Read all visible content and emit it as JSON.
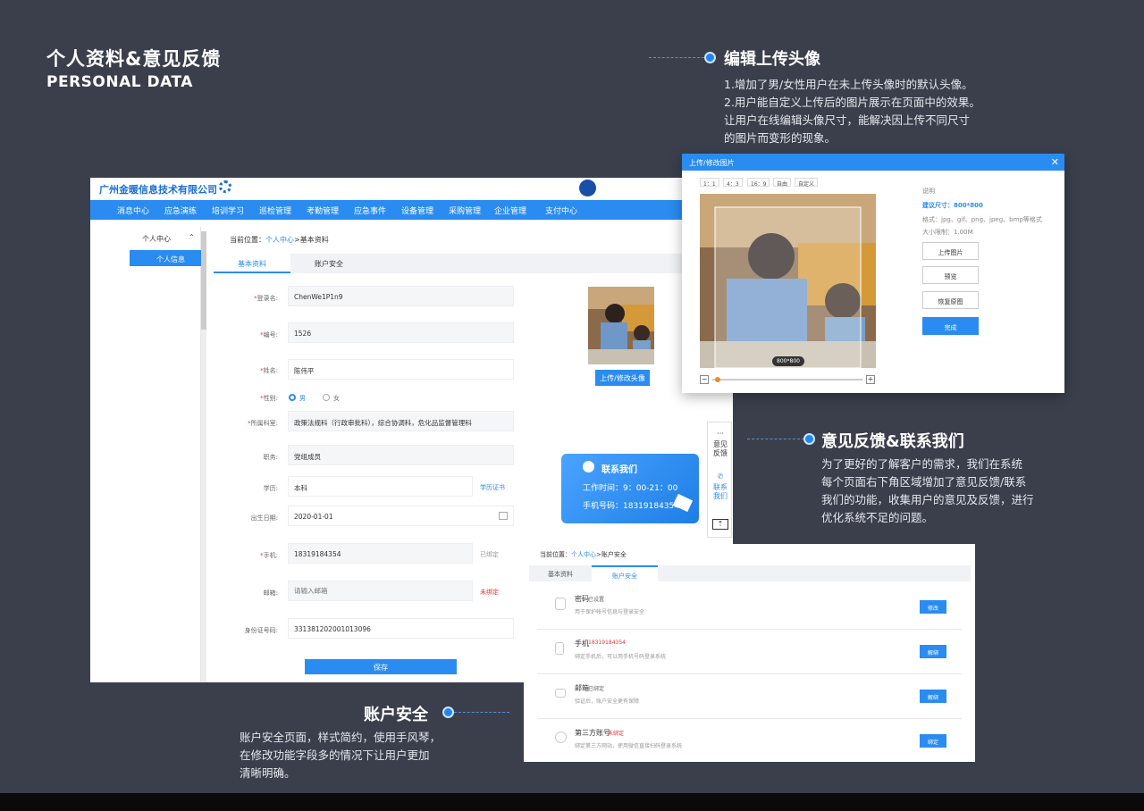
{
  "header": {
    "title": "个人资料&意见反馈",
    "subtitle": "PERSONAL DATA"
  },
  "sections": {
    "avatar": {
      "title": "编辑上传头像",
      "lines": [
        "1.增加了男/女性用户在未上传头像时的默认头像。",
        "2.用户能自定义上传后的图片展示在页面中的效果。",
        "让用户在线编辑头像尺寸，能解决因上传不同尺寸",
        "的图片而变形的现象。"
      ]
    },
    "feedback": {
      "title": "意见反馈&联系我们",
      "lines": [
        "为了更好的了解客户的需求，我们在系统",
        "每个页面右下角区域增加了意见反馈/联系",
        "我们的功能，收集用户的意见及反馈，进行",
        "优化系统不足的问题。"
      ]
    },
    "security": {
      "title": "账户安全",
      "lines": [
        "账户安全页面，样式简约，使用手风琴，",
        "在修改功能字段多的情况下让用户更加",
        "清晰明确。"
      ]
    }
  },
  "main": {
    "company": "广州金暖信息技术有限公司",
    "nav": [
      "消息中心",
      "应急演练",
      "培训学习",
      "巡检管理",
      "考勤管理",
      "应急事件",
      "设备管理",
      "采购管理",
      "企业管理",
      "支付中心"
    ],
    "sidebar": {
      "group": "个人中心",
      "active": "个人信息"
    },
    "breadcrumb": {
      "prefix": "当前位置：",
      "link": "个人中心",
      "current": ">基本资料"
    },
    "tabs": [
      "基本资料",
      "账户安全"
    ],
    "form": {
      "login_label": "登录名:",
      "login_value": "ChenWe1P1n9",
      "id_label": "编号:",
      "id_value": "1526",
      "name_label": "姓名:",
      "name_value": "陈伟平",
      "gender_label": "性别:",
      "gender_male": "男",
      "gender_female": "女",
      "dept_label": "所属科室:",
      "dept_value": "政策法规科（行政审批科），综合协调科，危化品监督管理科",
      "job_label": "职务:",
      "job_value": "党组成员",
      "edu_label": "学历:",
      "edu_value": "本科",
      "edu_link": "学历证书",
      "birth_label": "出生日期:",
      "birth_value": "2020-01-01",
      "phone_label": "手机:",
      "phone_value": "18319184354",
      "phone_status": "已绑定",
      "email_label": "邮箱:",
      "email_placeholder": "请输入邮箱",
      "email_status": "未绑定",
      "idcard_label": "身份证号码:",
      "idcard_value": "331381202001013096",
      "save": "保存"
    },
    "avatar_button": "上传/修改头像"
  },
  "contact": {
    "title": "联系我们",
    "hours": "工作时间：9：00-21：00",
    "phone": "手机号码：18319184354"
  },
  "float_bar": {
    "feedback": "意见反馈",
    "contact": "联系我们"
  },
  "dialog": {
    "title": "上传/修改图片",
    "ratios": [
      "1：1",
      "4：3",
      "16：9",
      "自由",
      "自定义"
    ],
    "size_badge": "800*800",
    "info_title": "说明",
    "info_size": "建议尺寸：800*800",
    "info_format": "格式：jpg、gif、png、jpeg、bmp等格式",
    "info_limit": "大小限制：1.00M",
    "btn_upload": "上传图片",
    "btn_preview": "预览",
    "btn_reset": "恢复原图",
    "btn_done": "完成",
    "zoom_level": 0.02
  },
  "account": {
    "breadcrumb": {
      "prefix": "当前位置：",
      "link": "个人中心",
      "current": ">账户安全"
    },
    "tabs": [
      "基本资料",
      "账户安全"
    ],
    "items": [
      {
        "name": "密码",
        "status": "已设置",
        "desc": "用于保护帐号信息与登录安全",
        "button": "修改"
      },
      {
        "name": "手机",
        "status": "18319184354",
        "desc": "绑定手机后，可以用手机号码登录系统",
        "button": "解绑"
      },
      {
        "name": "邮箱",
        "status": "已绑定",
        "desc": "验证后，账户安全更有保障",
        "button": "解绑"
      },
      {
        "name": "第三方账号",
        "status": "未绑定",
        "desc": "绑定第三方网站，使用微信直接扫码登录系统",
        "button": "绑定"
      }
    ]
  },
  "colors": {
    "background": "#3b3f4c",
    "primary": "#2a8cf0",
    "danger": "#e33333"
  }
}
